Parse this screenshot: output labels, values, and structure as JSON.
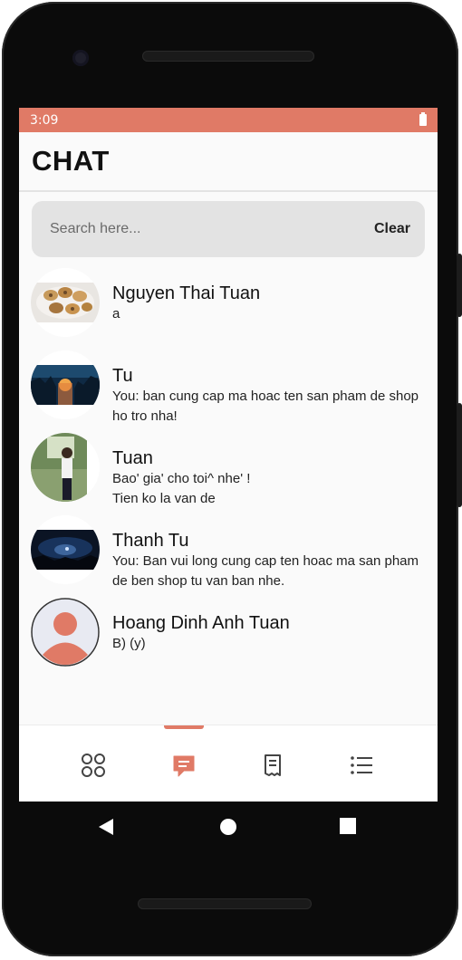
{
  "status_bar": {
    "time": "3:09"
  },
  "header": {
    "title": "CHAT"
  },
  "search": {
    "placeholder": "Search here...",
    "clear_label": "Clear"
  },
  "chats": [
    {
      "name": "Nguyen Thai Tuan",
      "message": "a",
      "avatar_icon": "food-photo-avatar"
    },
    {
      "name": "Tu",
      "message": "You: ban cung cap ma hoac ten san pham de shop ho tro nha!",
      "avatar_icon": "sunset-landscape-avatar"
    },
    {
      "name": "Tuan",
      "message_lines": [
        "Bao' gia' cho toi^ nhe' !",
        "Tien ko la van de"
      ],
      "avatar_icon": "person-photo-avatar"
    },
    {
      "name": "Thanh Tu",
      "message": "You: Ban vui long cung cap ten hoac ma san pham de ben shop tu van ban nhe.",
      "avatar_icon": "night-sky-avatar"
    },
    {
      "name": "Hoang Dinh Anh Tuan",
      "message": "B) (y)",
      "avatar_icon": "default-user-avatar"
    }
  ],
  "bottom_nav": {
    "items": [
      {
        "icon": "grid-icon",
        "active": false
      },
      {
        "icon": "chat-icon",
        "active": true
      },
      {
        "icon": "receipt-icon",
        "active": false
      },
      {
        "icon": "list-icon",
        "active": false
      }
    ],
    "active_color": "#e07a66"
  },
  "colors": {
    "accent": "#e07a66",
    "background": "#fafafa"
  }
}
